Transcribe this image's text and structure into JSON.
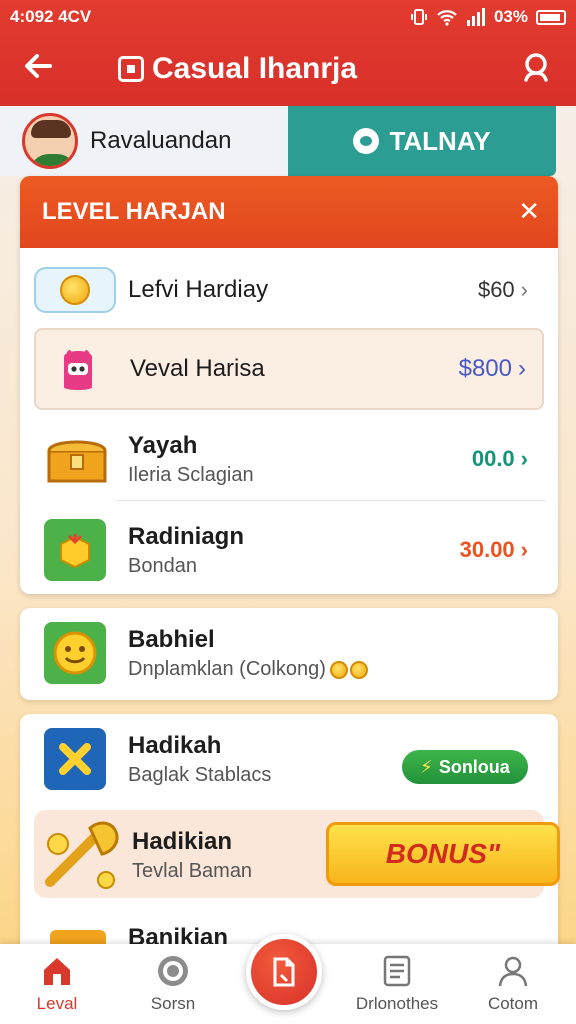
{
  "status_bar": {
    "time": "4:092 4CV",
    "battery": "03%"
  },
  "header": {
    "title": "Casual Ɩhanrja"
  },
  "profile": {
    "name": "Ravaluandan",
    "action_label": "TALNAY"
  },
  "level_panel": {
    "title": "LEVEL HARJAN",
    "items": [
      {
        "label": "Lefvi Hardiay",
        "amount": "$60",
        "amount_color": "#333333"
      },
      {
        "label": "Veval Harisa",
        "amount": "$800",
        "amount_color": "#4a58c2"
      },
      {
        "title": "Yayah",
        "subtitle": "Ileria Sclagian",
        "amount": "00.0",
        "amount_color": "#16947a"
      },
      {
        "title": "Radiniagn",
        "subtitle": "Bondan",
        "amount": "30.00",
        "amount_color": "#e8531f"
      }
    ]
  },
  "card_babhiel": {
    "title": "Babhiel",
    "subtitle": "Dnplamklan (Colkong)"
  },
  "card_hadikah": {
    "title": "Hadikah",
    "subtitle": "Baglak Stablacs",
    "pill_label": "Sonloua",
    "bonus_title": "Hadikian",
    "bonus_subtitle": "Tevlal Baman",
    "bonus_button": "BONUS\""
  },
  "peek_row": {
    "title": "Banikian"
  },
  "bottom_nav": {
    "items": [
      {
        "label": "Leval"
      },
      {
        "label": "Sorsn"
      },
      {
        "label": "Drlonothes"
      },
      {
        "label": "Cotom"
      }
    ]
  },
  "colors": {
    "accent": "#d9392c",
    "teal": "#2c9d93",
    "orange": "#e2461e"
  }
}
